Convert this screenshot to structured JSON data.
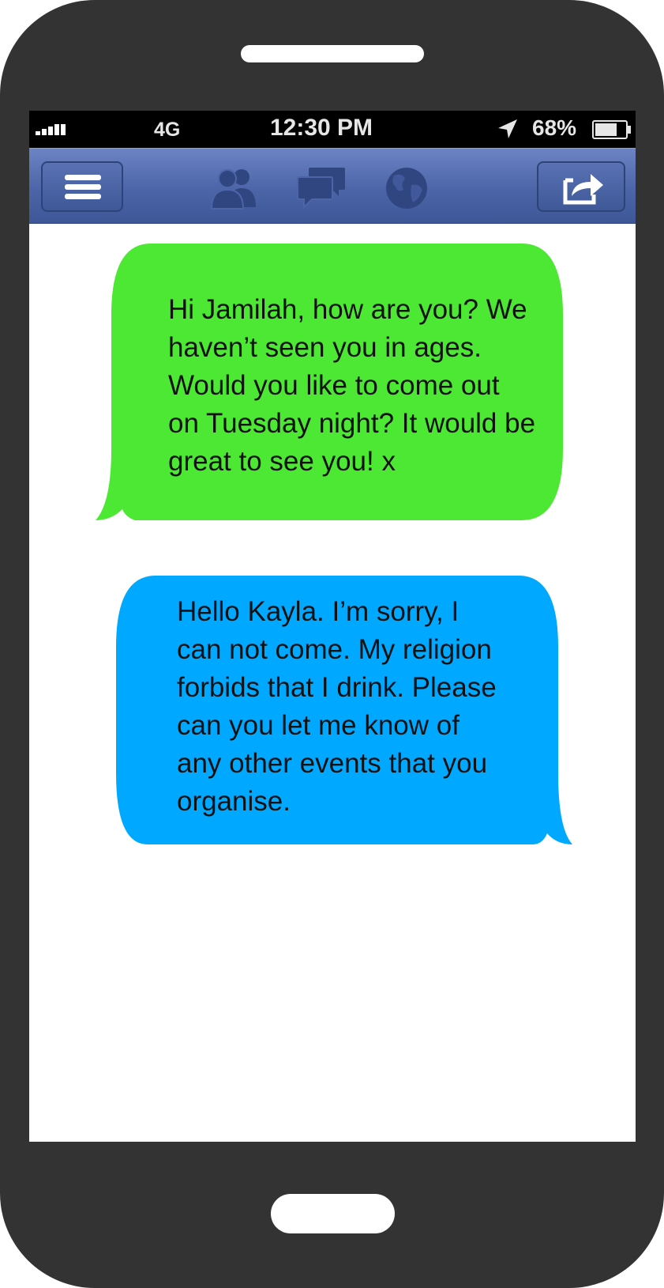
{
  "status_bar": {
    "network": "4G",
    "time": "12:30 PM",
    "battery_percent": "68%",
    "battery_level": 0.68,
    "icons": [
      "signal-bars-icon",
      "location-arrow-icon",
      "battery-icon"
    ]
  },
  "nav_bar": {
    "accent_color": "#4c65a8",
    "icons": [
      "menu-icon",
      "friends-icon",
      "messages-icon",
      "globe-icon",
      "share-icon"
    ]
  },
  "messages": [
    {
      "sender": "Kayla",
      "side": "left",
      "color": "#4de833",
      "text": "Hi Jamilah, how are you? We\nhaven’t seen you in ages.\nWould you like to come out\non Tuesday night? It would be\ngreat to see you! x"
    },
    {
      "sender": "Jamilah",
      "side": "right",
      "color": "#00a9ff",
      "text": "Hello Kayla. I’m sorry, I\ncan not come. My religion\nforbids that I drink. Please\ncan you let me know of\nany other events that you\norganise."
    }
  ]
}
